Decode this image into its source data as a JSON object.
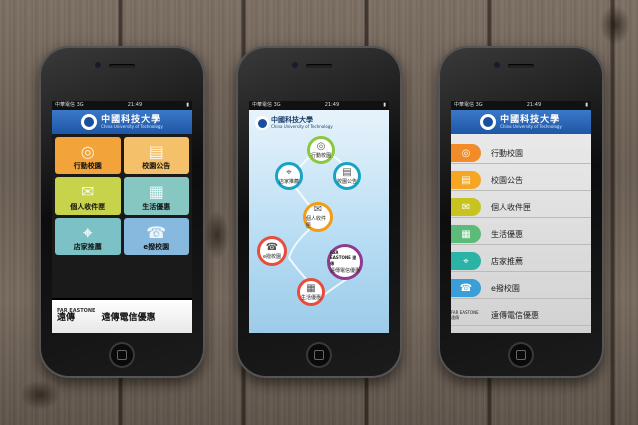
{
  "status": {
    "carrier": "中華電信 3G",
    "time": "21:49"
  },
  "university": {
    "name_cn": "中國科技大學",
    "name_en": "China University of Technology"
  },
  "phone1": {
    "tiles": [
      {
        "label": "行動校園",
        "icon": "globe-icon",
        "color": "#f2a33a"
      },
      {
        "label": "校園公告",
        "icon": "document-icon",
        "color": "#f4c06a"
      },
      {
        "label": "個人收件匣",
        "icon": "envelope-icon",
        "color": "#c7d34b"
      },
      {
        "label": "生活優惠",
        "icon": "shop-icon",
        "color": "#86c7c2"
      },
      {
        "label": "店家推薦",
        "icon": "location-icon",
        "color": "#7bc1c5"
      },
      {
        "label": "e撥校園",
        "icon": "phone-icon",
        "color": "#86b9dd"
      }
    ],
    "promo": {
      "brand_top": "FAR EASTONE",
      "brand_cn": "遠傳",
      "label": "遠傳電信優惠"
    }
  },
  "phone2": {
    "bubbles": [
      {
        "label": "行動校園",
        "icon": "globe-icon",
        "ring": "#8dc63f"
      },
      {
        "label": "校園公告",
        "icon": "document-icon",
        "ring": "#16a3c4"
      },
      {
        "label": "店家推薦",
        "icon": "location-icon",
        "ring": "#16a3c4"
      },
      {
        "label": "個人收件匣",
        "icon": "envelope-icon",
        "ring": "#f39c12"
      },
      {
        "label": "e撥校園",
        "icon": "phone-icon",
        "ring": "#e74c3c"
      },
      {
        "label": "遠傳電信優惠",
        "icon": "brand-icon",
        "ring": "#8e3b8f",
        "brand": "FAR EASTONE 遠傳"
      },
      {
        "label": "生活優惠",
        "icon": "shop-icon",
        "ring": "#e74c3c"
      }
    ]
  },
  "phone3": {
    "rows": [
      {
        "label": "行動校園",
        "icon": "globe-icon",
        "color": "#f28c28"
      },
      {
        "label": "校園公告",
        "icon": "document-icon",
        "color": "#f5a623"
      },
      {
        "label": "個人收件匣",
        "icon": "envelope-icon",
        "color": "#c8c31f"
      },
      {
        "label": "生活優惠",
        "icon": "shop-icon",
        "color": "#5dbb7a"
      },
      {
        "label": "店家推薦",
        "icon": "location-icon",
        "color": "#2bb3a6"
      },
      {
        "label": "e撥校園",
        "icon": "phone-icon",
        "color": "#3a9fd8"
      },
      {
        "label": "遠傳電信優惠",
        "icon": "brand-icon",
        "color": "#888888",
        "brand": "FAR EASTONE 遠傳"
      }
    ]
  }
}
